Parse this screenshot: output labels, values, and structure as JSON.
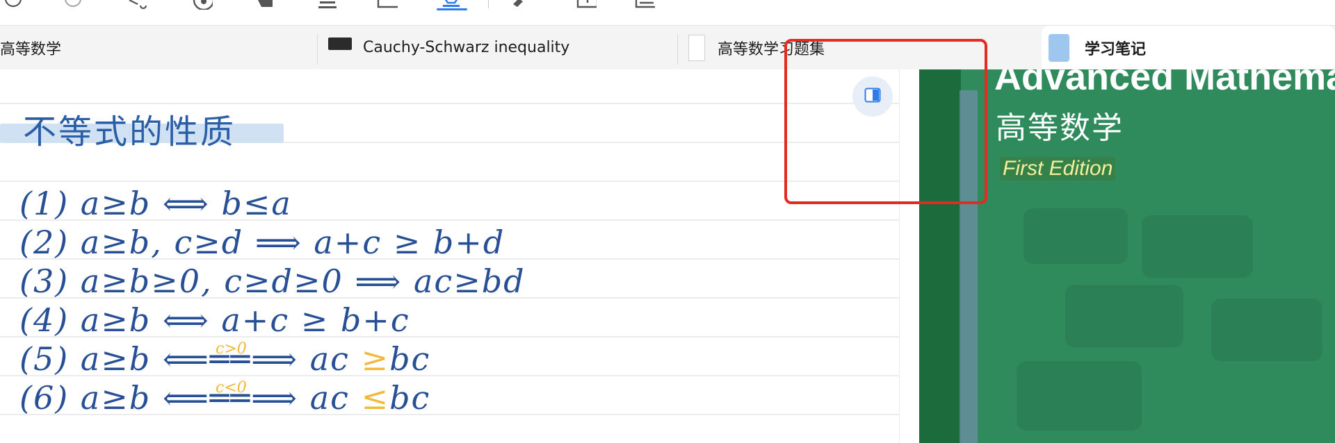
{
  "toolbar": {
    "icons": [
      "redo-circle-icon",
      "circle-icon",
      "lasso-icon",
      "gear-icon",
      "eraser-icon",
      "highlighter-icon",
      "crop-icon",
      "text-pen-icon",
      "pen-icon",
      "insert-icon",
      "image-icon"
    ],
    "active": "text-pen-icon",
    "accent": "#2f7ce8"
  },
  "tabs": [
    {
      "label": "高等数学",
      "icon": "none",
      "active": false
    },
    {
      "label": "Cauchy-Schwarz inequality",
      "icon": "dark-thumbnail-icon",
      "active": false
    },
    {
      "label": "高等数学习题集",
      "icon": "document-thumbnail-icon",
      "active": false
    },
    {
      "label": "学习笔记",
      "icon": "notebook-icon",
      "active": true
    }
  ],
  "note": {
    "heading": "、不等式的性质",
    "lines": [
      "(1) a≥b ⟺ b≤a",
      "(2) a≥b, c≥d ⟹ a+c ≥ b+d",
      "(3) a≥b≥0, c≥d≥0 ⟹ ac≥bd",
      "(4) a≥b ⟺ a+c ≥ b+c",
      "(5) a≥b ⟺ ac ≥ bc",
      "(6) a≥b ⟺ ac ≤ bc"
    ],
    "line5": {
      "lhs": "(5) a≥b ⟸",
      "arrow": "══",
      "rhs_a": "⟹ ac",
      "op": "≥",
      "rhs_b": "bc",
      "cond": "c>0"
    },
    "line6": {
      "lhs": "(6) a≥b ⟸",
      "arrow": "══",
      "rhs_a": "⟹ ac",
      "op": "≤",
      "rhs_b": "bc",
      "cond": "c<0"
    }
  },
  "cover": {
    "title_en": "Advanced Mathema",
    "title_cn": "高等数学",
    "edition": "First Edition"
  },
  "annotation_color": "#e42b22"
}
